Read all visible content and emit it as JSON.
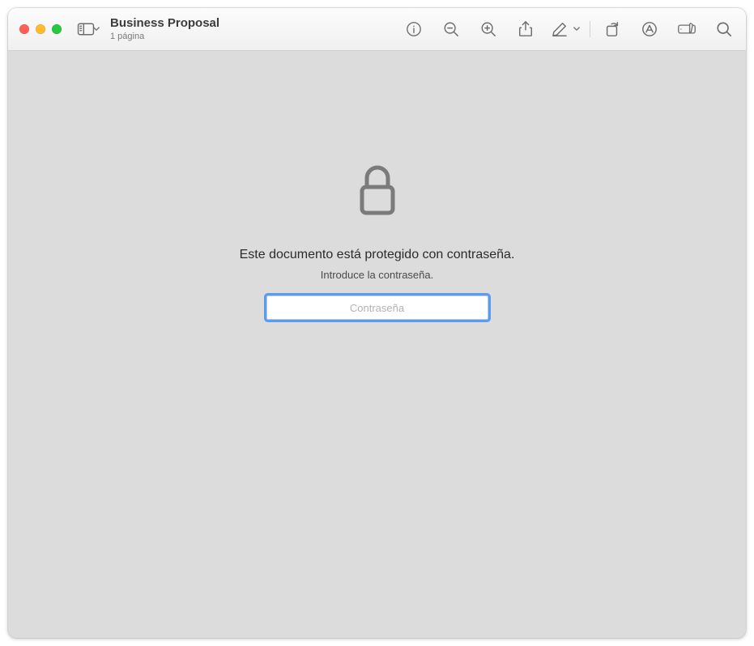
{
  "document": {
    "title": "Business Proposal",
    "subtitle": "1 página"
  },
  "toolbar": {
    "sidebar_icon": "sidebar-icon",
    "info_icon": "info-icon",
    "zoom_out_icon": "zoom-out-icon",
    "zoom_in_icon": "zoom-in-icon",
    "share_icon": "share-icon",
    "highlight_icon": "highlight-icon",
    "rotate_icon": "rotate-icon",
    "markup_icon": "markup-icon",
    "form_icon": "form-icon",
    "search_icon": "search-icon"
  },
  "lock_panel": {
    "main": "Este documento está protegido con contraseña.",
    "sub": "Introduce la contraseña.",
    "placeholder": "Contraseña"
  }
}
